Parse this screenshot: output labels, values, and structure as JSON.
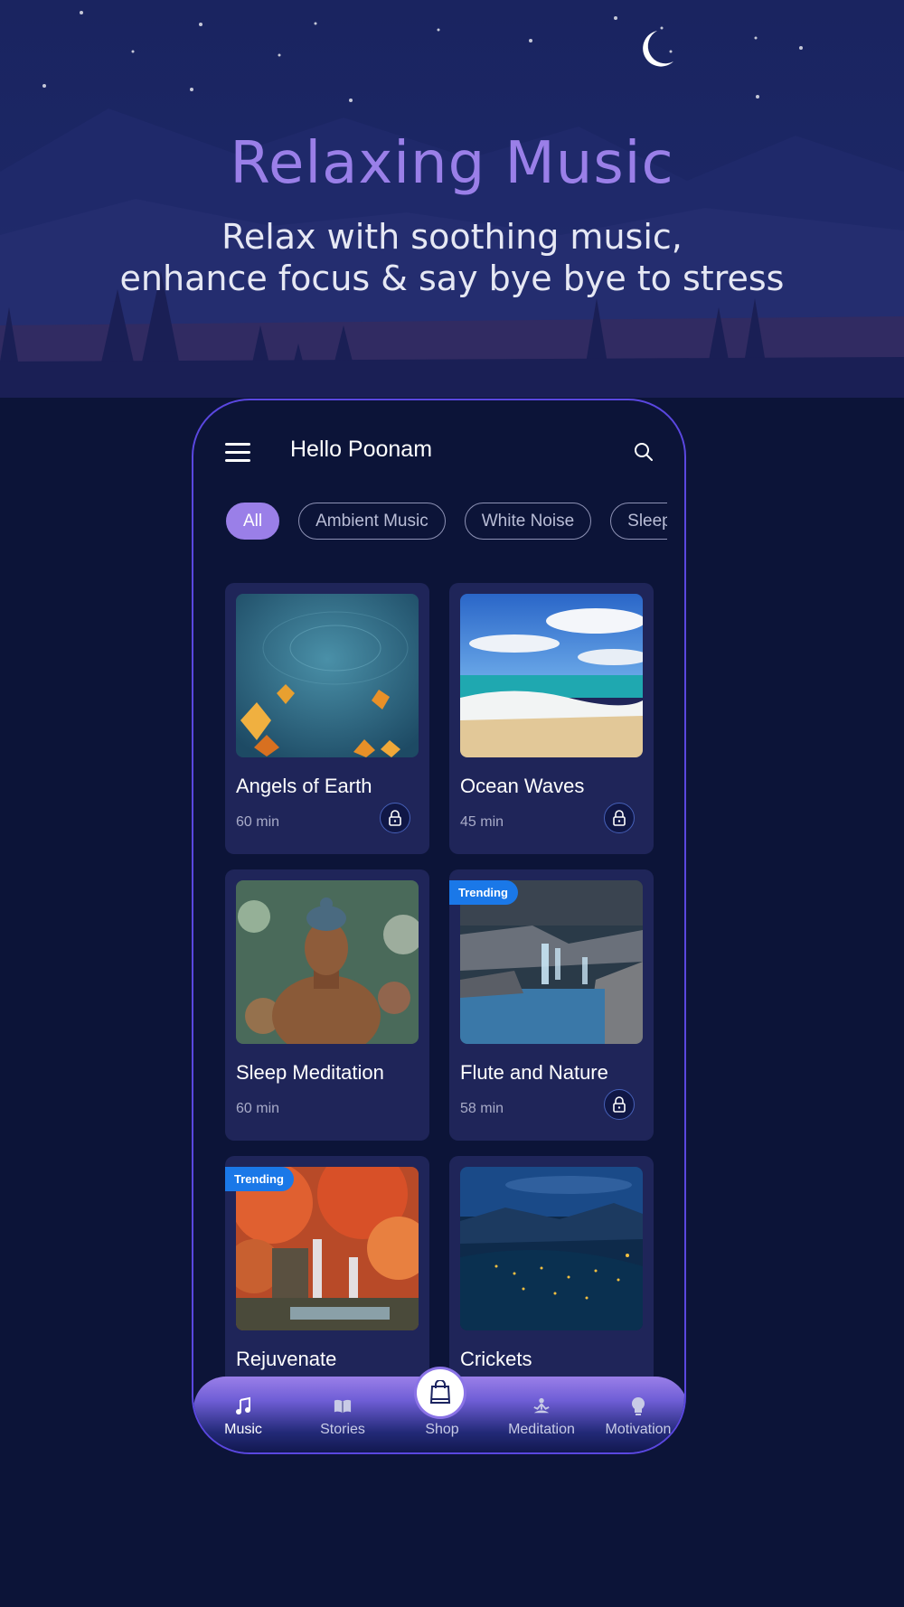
{
  "hero": {
    "title": "Relaxing Music",
    "subtitle_line1": "Relax with soothing music,",
    "subtitle_line2": "enhance focus & say bye bye to stress"
  },
  "app": {
    "greeting": "Hello Poonam",
    "icons": {
      "menu": "hamburger-menu-icon",
      "search": "search-icon"
    },
    "filters": [
      {
        "label": "All",
        "active": true
      },
      {
        "label": "Ambient Music",
        "active": false
      },
      {
        "label": "White Noise",
        "active": false
      },
      {
        "label": "Sleep",
        "active": false
      }
    ],
    "tracks": [
      {
        "title": "Angels of Earth",
        "duration": "60 min",
        "locked": true,
        "badge": "",
        "image": "autumn leaves on water"
      },
      {
        "title": "Ocean Waves",
        "duration": "45 min",
        "locked": true,
        "badge": "",
        "image": "tropical beach"
      },
      {
        "title": "Sleep Meditation",
        "duration": "60 min",
        "locked": false,
        "badge": "",
        "image": "buddha statue"
      },
      {
        "title": "Flute and Nature",
        "duration": "58 min",
        "locked": true,
        "badge": "Trending",
        "image": "waterfall on rocks"
      },
      {
        "title": "Rejuvenate",
        "duration": "",
        "locked": false,
        "badge": "Trending",
        "image": "autumn waterfall"
      },
      {
        "title": "Crickets",
        "duration": "",
        "locked": false,
        "badge": "",
        "image": "night rice terraces"
      }
    ],
    "bottom_nav": [
      {
        "label": "Music",
        "icon": "music-note-icon",
        "active": true
      },
      {
        "label": "Stories",
        "icon": "book-icon",
        "active": false
      },
      {
        "label": "Shop",
        "icon": "shopping-bag-icon",
        "active": false
      },
      {
        "label": "Meditation",
        "icon": "meditation-icon",
        "active": false
      },
      {
        "label": "Motivation",
        "icon": "lightbulb-icon",
        "active": false
      }
    ]
  },
  "colors": {
    "background": "#0c1438",
    "accent": "#9a7fe8",
    "card": "#1f2559",
    "badge": "#1a78e8",
    "phone_border": "#5a47e0"
  }
}
